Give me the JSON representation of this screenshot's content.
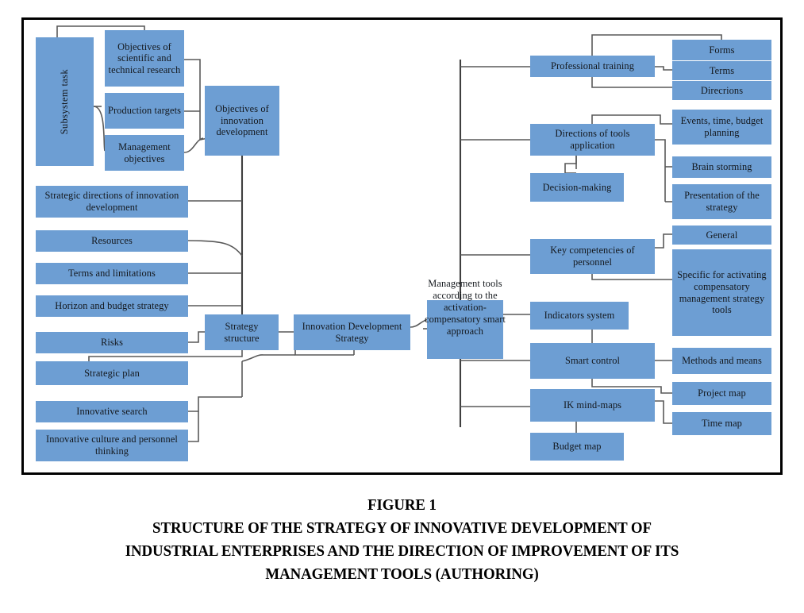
{
  "figure": {
    "caption_lines": [
      "FIGURE 1",
      "STRUCTURE OF THE STRATEGY OF INNOVATIVE DEVELOPMENT OF",
      "INDUSTRIAL ENTERPRISES AND THE DIRECTION OF IMPROVEMENT OF ITS",
      "MANAGEMENT TOOLS (AUTHORING)"
    ]
  },
  "colors": {
    "node_fill": "#6d9ed3",
    "edge": "#595959",
    "frame_border": "#000000",
    "background": "#ffffff",
    "text": "#14181d"
  },
  "nodes": {
    "subsystem_task": "Subsystem task",
    "objectives_sci_tech": "Objectives of scientific and technical research",
    "production_targets": "Production targets",
    "management_objectives": "Management objectives",
    "objectives_innovation_dev": "Objectives of innovation development",
    "strategic_directions": "Strategic directions of innovation development",
    "resources": "Resources",
    "terms_limitations": "Terms and limitations",
    "horizon_budget": "Horizon and budget strategy",
    "risks": "Risks",
    "strategic_plan": "Strategic plan",
    "innovative_search": "Innovative search",
    "innovative_culture": "Innovative culture and personnel thinking",
    "strategy_structure": "Strategy structure",
    "innovation_development_strategy": "Innovation Development Strategy",
    "management_tools": "Management tools according to the activation-compensatory smart approach",
    "professional_training": "Professional training",
    "forms": "Forms",
    "terms": "Terms",
    "directions": "Direcrions",
    "directions_of_tools_application": "Directions of tools application",
    "decision_making": "Decision-making",
    "events_time_budget": "Events, time, budget planning",
    "brain_storming": "Brain storming",
    "presentation_of_strategy": "Presentation of the strategy",
    "key_competencies": "Key competencies of personnel",
    "general": "General",
    "specific_for_activating": "Specific for activating compensatory management strategy tools",
    "indicators_system": "Indicators system",
    "smart_control": "Smart control",
    "methods_and_means": "Methods and means",
    "ik_mind_maps": "IK mind-maps",
    "project_map": "Project map",
    "time_map": "Time map",
    "budget_map": "Budget map"
  }
}
